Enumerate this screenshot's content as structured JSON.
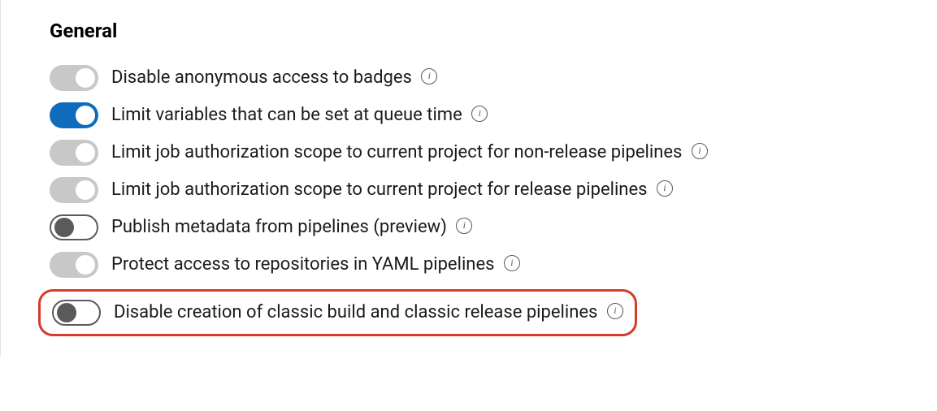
{
  "section": {
    "title": "General"
  },
  "settings": [
    {
      "id": "disable-anonymous-badges",
      "label": "Disable anonymous access to badges",
      "toggleStyle": "off-gray"
    },
    {
      "id": "limit-variables-queue",
      "label": "Limit variables that can be set at queue time",
      "toggleStyle": "on-blue"
    },
    {
      "id": "limit-job-auth-nonrelease",
      "label": "Limit job authorization scope to current project for non-release pipelines",
      "toggleStyle": "off-gray"
    },
    {
      "id": "limit-job-auth-release",
      "label": "Limit job authorization scope to current project for release pipelines",
      "toggleStyle": "off-gray"
    },
    {
      "id": "publish-metadata",
      "label": "Publish metadata from pipelines (preview)",
      "toggleStyle": "outline"
    },
    {
      "id": "protect-repo-yaml",
      "label": "Protect access to repositories in YAML pipelines",
      "toggleStyle": "off-gray"
    },
    {
      "id": "disable-classic-pipelines",
      "label": "Disable creation of classic build and classic release pipelines",
      "toggleStyle": "outline",
      "highlighted": true
    }
  ]
}
